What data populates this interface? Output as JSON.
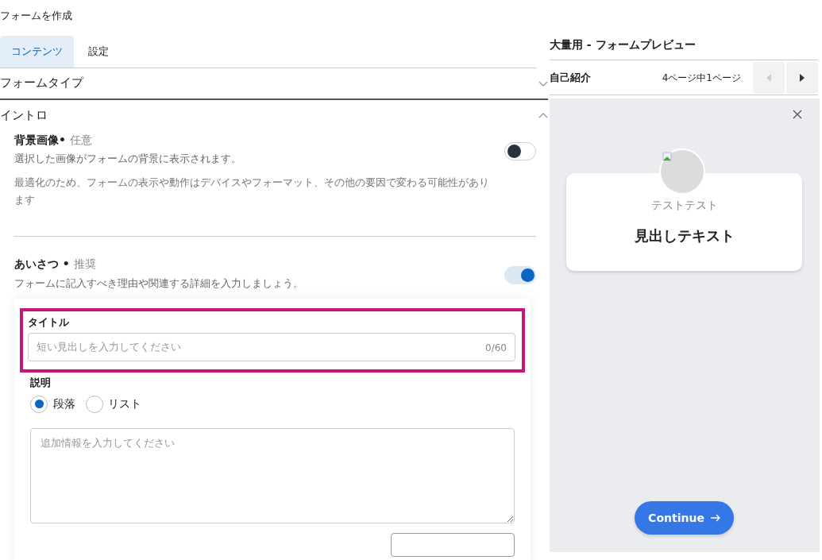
{
  "page_title": "フォームを作成",
  "tabs": [
    {
      "label": "コンテンツ",
      "selected": true
    },
    {
      "label": "設定",
      "selected": false
    }
  ],
  "sections": [
    {
      "title": "フォームタイプ",
      "expanded": false
    },
    {
      "title": "イントロ",
      "expanded": true
    }
  ],
  "settings": [
    {
      "label": "背景画像•",
      "tag": "任意",
      "on": false,
      "description": "選択した画像がフォームの背景に表示されます。",
      "note": "最適化のため、フォームの表示や動作はデバイスやフォーマット、その他の要因で変わる可能性があります"
    },
    {
      "label": "あいさつ •",
      "tag": "推奨",
      "on": true,
      "description": "フォームに記入すべき理由や関連する詳細を入力しましょう。"
    }
  ],
  "title_field": {
    "label": "タイトル",
    "placeholder": "短い見出しを入力してください",
    "counter": "0/60",
    "highlighted": true
  },
  "description_field": {
    "label": "説明",
    "placeholder": "追加情報を入力してください",
    "options": [
      {
        "label": "段落",
        "selected": true
      },
      {
        "label": "リスト",
        "selected": false
      }
    ]
  },
  "preview": {
    "title": "大量用 - フォームプレビュー",
    "page_name": "自己紹介",
    "page_indicator": "4ページ中1ページ",
    "prev_disabled": true,
    "next_disabled": false,
    "subtitle": "テストテスト",
    "heading": "見出しテキスト",
    "button": "Continue"
  }
}
